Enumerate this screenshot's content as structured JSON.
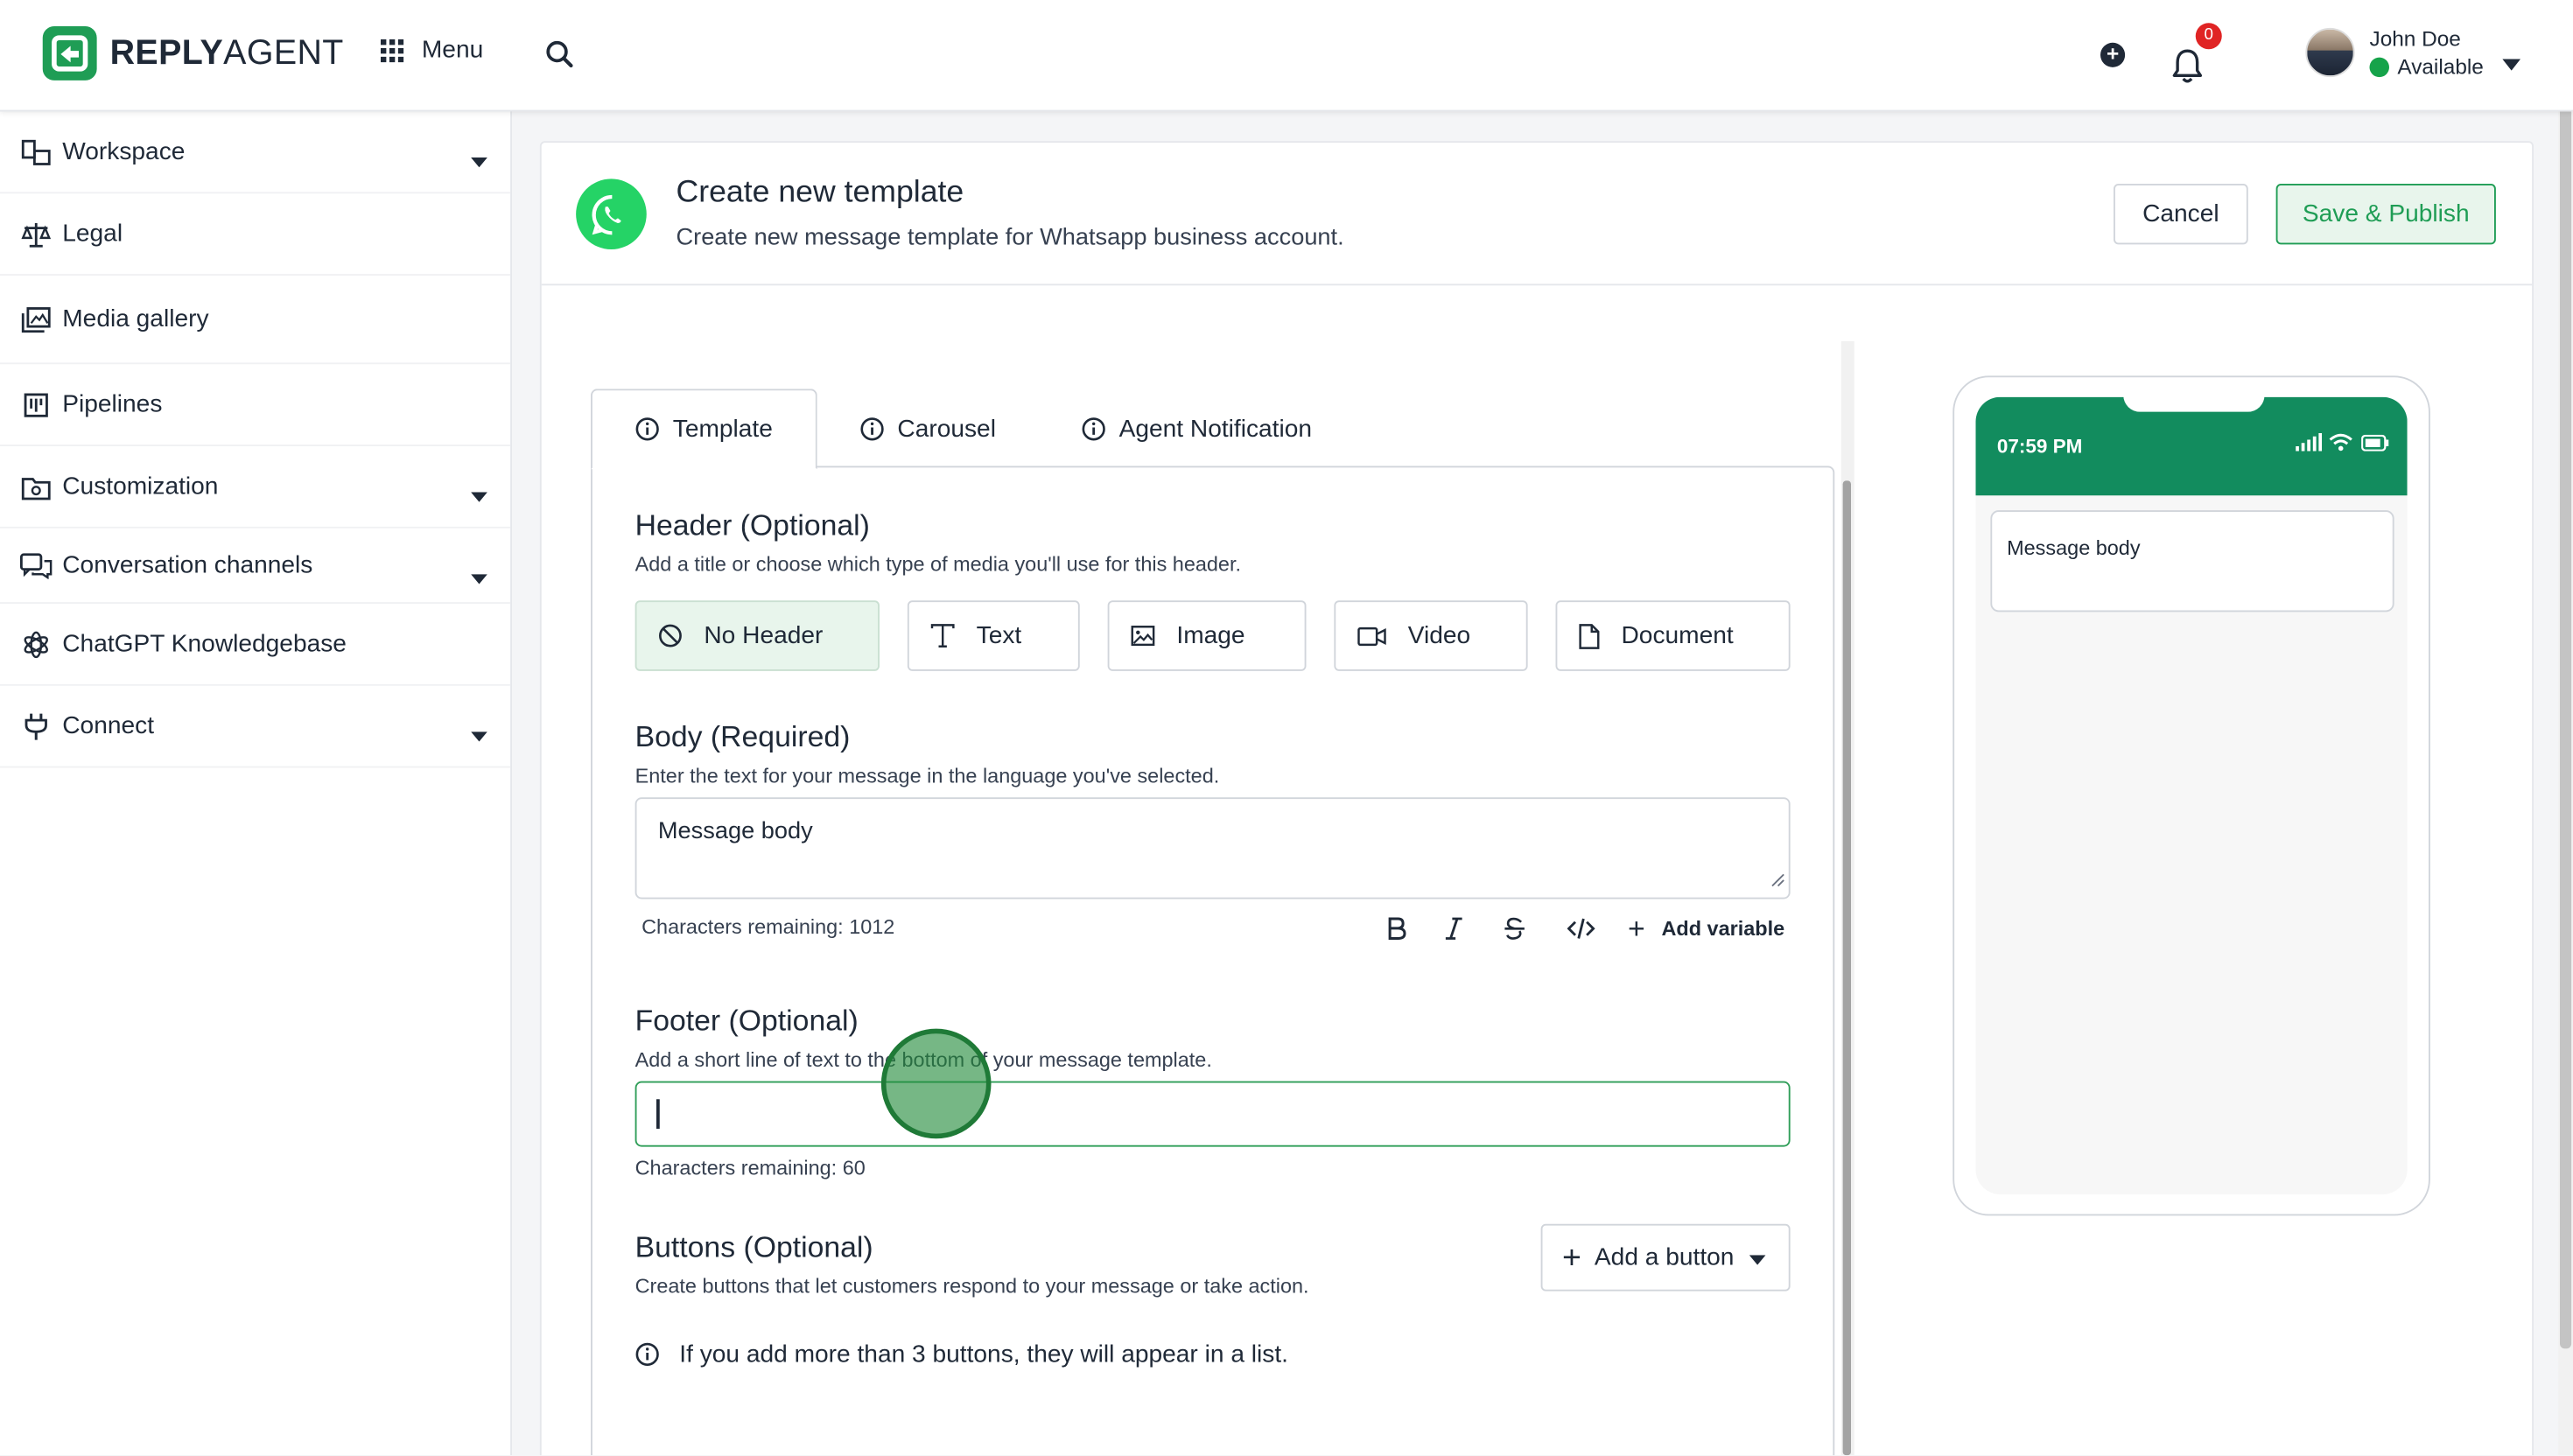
{
  "header": {
    "logo_bold": "REPLY",
    "logo_light": "AGENT",
    "menu_label": "Menu",
    "notification_count": "0",
    "user_name": "John Doe",
    "user_status": "Available"
  },
  "sidebar": {
    "items": [
      {
        "label": "Workspace",
        "icon": "workspace-icon",
        "has_caret": true
      },
      {
        "label": "Legal",
        "icon": "scale-icon",
        "has_caret": false
      },
      {
        "label": "Media gallery",
        "icon": "media-gallery-icon",
        "has_caret": false
      },
      {
        "label": "Pipelines",
        "icon": "pipelines-icon",
        "has_caret": false
      },
      {
        "label": "Customization",
        "icon": "customization-icon",
        "has_caret": true
      },
      {
        "label": "Conversation channels",
        "icon": "chat-bubbles-icon",
        "has_caret": true
      },
      {
        "label": "ChatGPT Knowledgebase",
        "icon": "openai-icon",
        "has_caret": false
      },
      {
        "label": "Connect",
        "icon": "plug-icon",
        "has_caret": true
      }
    ]
  },
  "page": {
    "title": "Create new template",
    "subtitle": "Create new message template for Whatsapp business account.",
    "cancel_label": "Cancel",
    "save_label": "Save & Publish"
  },
  "tabs": [
    {
      "label": "Template",
      "active": true
    },
    {
      "label": "Carousel",
      "active": false
    },
    {
      "label": "Agent Notification",
      "active": false
    }
  ],
  "header_section": {
    "title": "Header (Optional)",
    "description": "Add a title or choose which type of media you'll use for this header.",
    "options": [
      {
        "label": "No Header",
        "icon": "ban-icon",
        "selected": true
      },
      {
        "label": "Text",
        "icon": "text-icon",
        "selected": false
      },
      {
        "label": "Image",
        "icon": "image-icon",
        "selected": false
      },
      {
        "label": "Video",
        "icon": "video-icon",
        "selected": false
      },
      {
        "label": "Document",
        "icon": "document-icon",
        "selected": false
      }
    ]
  },
  "body_section": {
    "title": "Body (Required)",
    "description": "Enter the text for your message in the language you've selected.",
    "value": "Message body",
    "chars_remaining": "Characters remaining: 1012",
    "add_variable": "Add variable"
  },
  "footer_section": {
    "title": "Footer (Optional)",
    "description": "Add a short line of text to the bottom of your message template.",
    "value": "",
    "chars_remaining": "Characters remaining: 60"
  },
  "buttons_section": {
    "title": "Buttons (Optional)",
    "description": "Create buttons that let customers respond to your message or take action.",
    "add_button": "Add a button",
    "info": "If you add more than 3 buttons, they will appear in a list."
  },
  "preview": {
    "time": "07:59 PM",
    "message": "Message body"
  },
  "colors": {
    "brand_green": "#1f9d55",
    "whatsapp_green": "#25d366",
    "phone_header": "#128c5e"
  }
}
